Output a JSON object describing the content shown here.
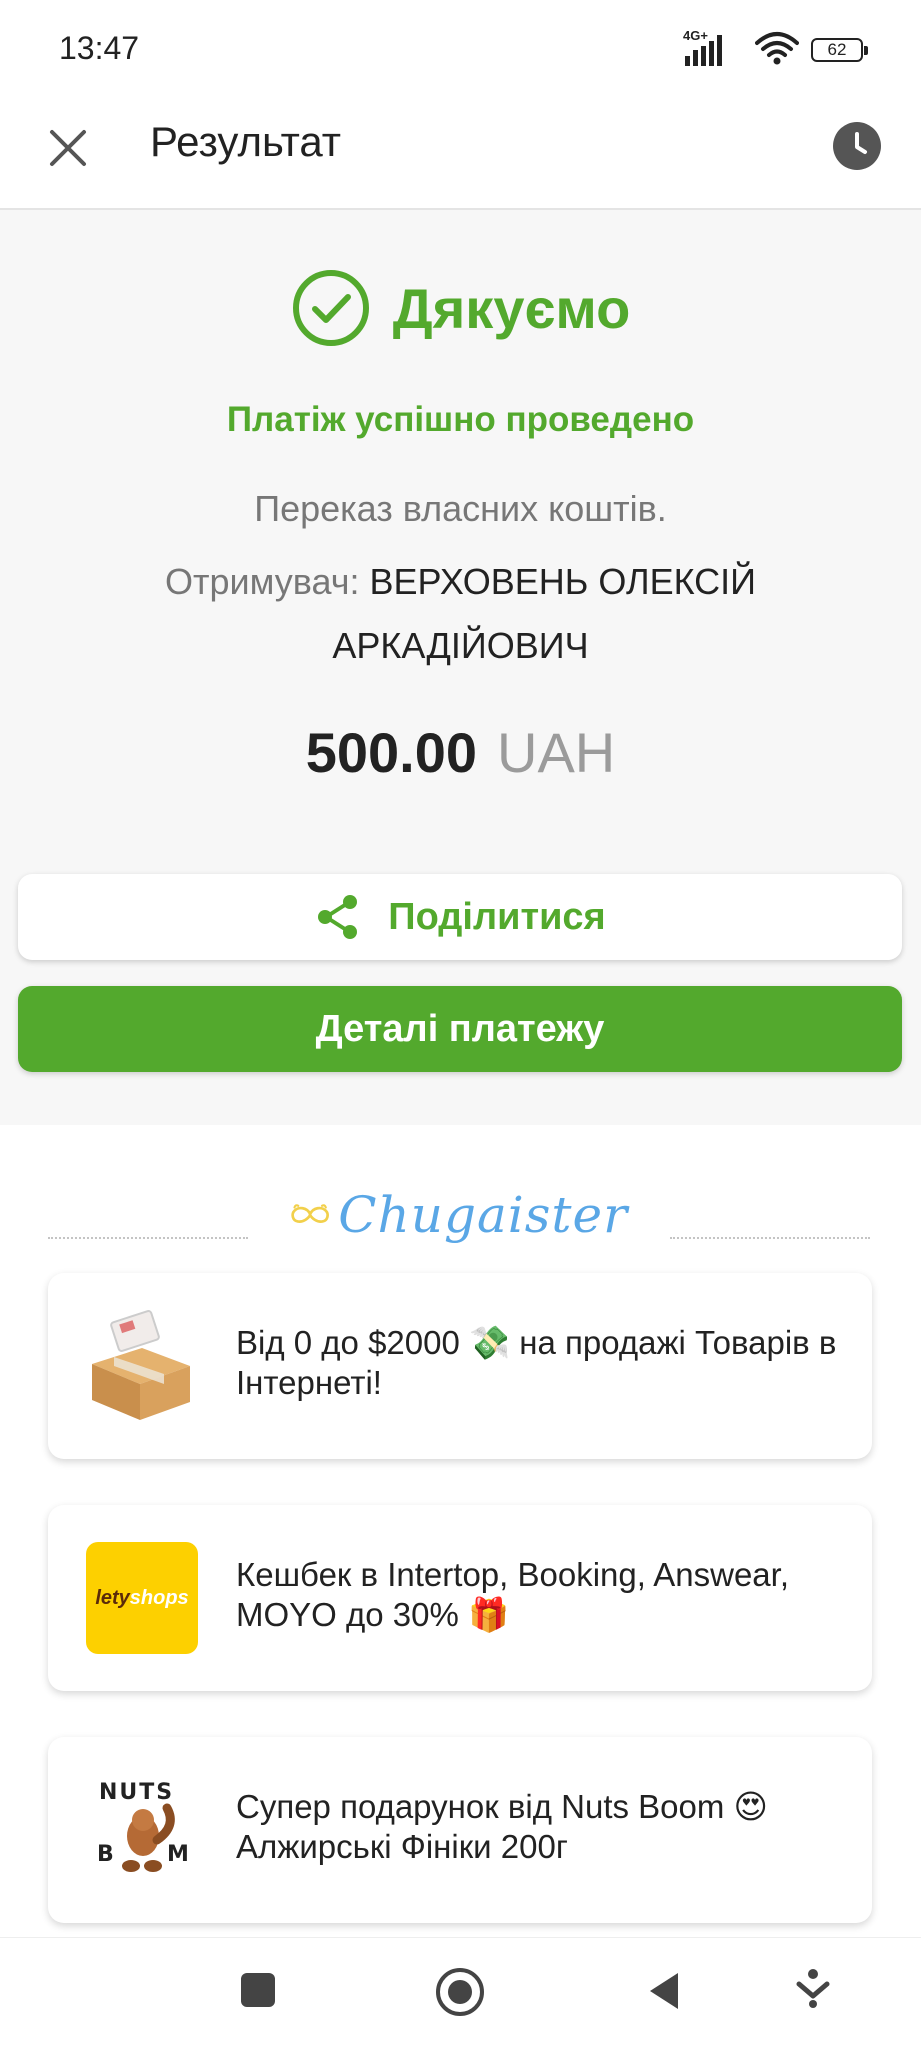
{
  "status_bar": {
    "time": "13:47",
    "network": "4G+",
    "battery": "62"
  },
  "app_bar": {
    "title": "Результат"
  },
  "result": {
    "heading": "Дякуємо",
    "status": "Платіж успішно проведено",
    "description": "Переказ власних коштів.",
    "recipient_label": "Отримувач:",
    "recipient_name": "ВЕРХОВЕНЬ ОЛЕКСІЙ АРКАДІЙОВИЧ",
    "amount": "500.00",
    "currency": "UAH"
  },
  "actions": {
    "share_label": "Поділитися",
    "details_label": "Деталі платежу"
  },
  "promo": {
    "brand": "Chugaister",
    "items": [
      {
        "text": "Від 0 до $2000 💸 на продажі Товарів в Інтернеті!",
        "icon": "box-icon"
      },
      {
        "text": "Кешбек в Intertop, Booking, Answear, MOYO до 30% 🎁",
        "logo_main": "lety",
        "logo_accent": "shops"
      },
      {
        "text": "Супер подарунок від Nuts Boom 😍 Алжирські Фініки 200г",
        "logo_top": "NUTS",
        "logo_bottom_left": "B",
        "logo_bottom_right": "M"
      }
    ]
  },
  "colors": {
    "accent": "#53a92d",
    "brand_blue": "#5aa7e6",
    "brand_yellow": "#f2d04b",
    "lety_yellow": "#fdd000"
  }
}
